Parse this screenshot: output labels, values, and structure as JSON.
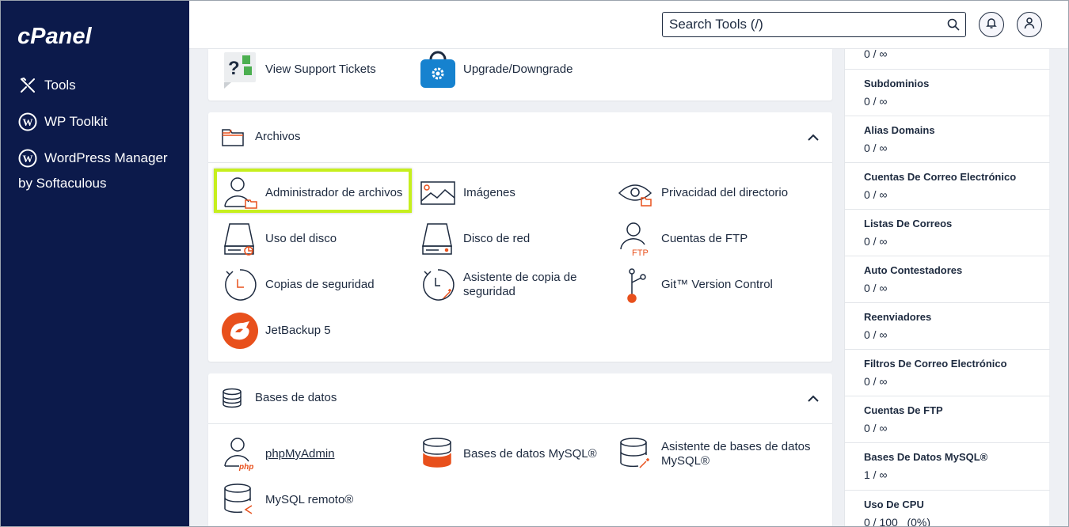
{
  "sidebar": {
    "logo_text": "cPanel",
    "items": [
      {
        "label": "Tools",
        "icon": "tools-icon"
      },
      {
        "label": "WP Toolkit",
        "icon": "wordpress-icon"
      },
      {
        "label": "WordPress Manager",
        "icon": "wordpress-icon"
      }
    ],
    "item3_sub": "by Softaculous"
  },
  "header": {
    "search_placeholder": "Search Tools (/)",
    "notifications_icon": "bell-icon",
    "user_icon": "user-icon"
  },
  "top_card": {
    "tools": [
      {
        "label": "View Support Tickets",
        "icon": "support-tickets-icon"
      },
      {
        "label": "Upgrade/Downgrade",
        "icon": "upgrade-bag-icon"
      }
    ]
  },
  "files_card": {
    "title": "Archivos",
    "tools": [
      {
        "label": "Administrador de archivos",
        "icon": "file-manager-icon"
      },
      {
        "label": "Imágenes",
        "icon": "images-icon"
      },
      {
        "label": "Privacidad del directorio",
        "icon": "directory-privacy-icon"
      },
      {
        "label": "Uso del disco",
        "icon": "disk-usage-icon"
      },
      {
        "label": "Disco de red",
        "icon": "network-disk-icon"
      },
      {
        "label": "Cuentas de FTP",
        "icon": "ftp-accounts-icon"
      },
      {
        "label": "Copias de seguridad",
        "icon": "backup-icon"
      },
      {
        "label": "Asistente de copia de seguridad",
        "icon": "backup-wizard-icon"
      },
      {
        "label": "Git™ Version Control",
        "icon": "git-icon"
      },
      {
        "label": "JetBackup 5",
        "icon": "jetbackup-icon"
      }
    ]
  },
  "db_card": {
    "title": "Bases de datos",
    "tools": [
      {
        "label": "phpMyAdmin",
        "icon": "phpmyadmin-icon"
      },
      {
        "label": "Bases de datos MySQL®",
        "icon": "mysql-databases-icon"
      },
      {
        "label": "Asistente de bases de datos MySQL®",
        "icon": "mysql-wizard-icon"
      },
      {
        "label": "MySQL remoto®",
        "icon": "remote-mysql-icon"
      }
    ]
  },
  "stats": [
    {
      "name": "",
      "value": "0 / ∞"
    },
    {
      "name": "Subdominios",
      "value": "0 / ∞"
    },
    {
      "name": "Alias Domains",
      "value": "0 / ∞"
    },
    {
      "name": "Cuentas De Correo Electrónico",
      "value": "0 / ∞"
    },
    {
      "name": "Listas De Correos",
      "value": "0 / ∞"
    },
    {
      "name": "Auto Contestadores",
      "value": "0 / ∞"
    },
    {
      "name": "Reenviadores",
      "value": "0 / ∞"
    },
    {
      "name": "Filtros De Correo Electrónico",
      "value": "0 / ∞"
    },
    {
      "name": "Cuentas De FTP",
      "value": "0 / ∞"
    },
    {
      "name": "Bases De Datos MySQL®",
      "value": "1 / ∞"
    },
    {
      "name": "Uso De CPU",
      "value": "0 / 100   (0%)"
    }
  ],
  "colors": {
    "sidebar_bg": "#0c1a4b",
    "accent_orange": "#e8501c",
    "highlight": "#c6ef1e",
    "text": "#1d2a3f"
  }
}
